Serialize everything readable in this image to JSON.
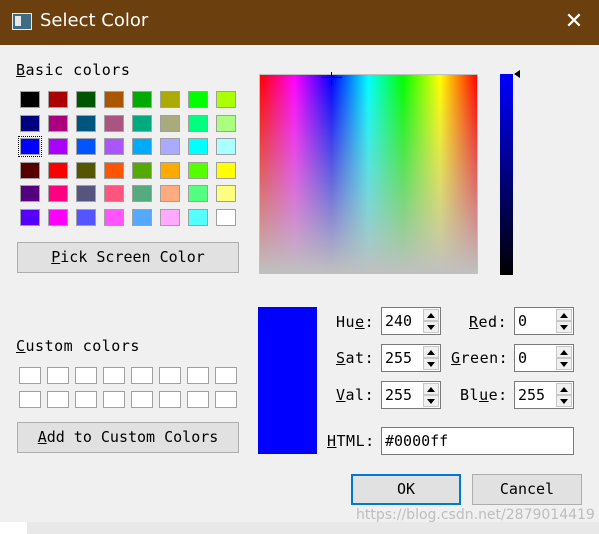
{
  "window": {
    "title": "Select Color",
    "close_glyph": "✕"
  },
  "basic_colors": {
    "label": "Basic colors",
    "selected_index": 16,
    "swatches": [
      "#000000",
      "#aa0000",
      "#005500",
      "#aa5500",
      "#00aa00",
      "#aaaa00",
      "#00ff00",
      "#aaff00",
      "#00007f",
      "#aa007f",
      "#00557f",
      "#aa557f",
      "#00aa7f",
      "#aaaa7f",
      "#00ff7f",
      "#aaff7f",
      "#0000ff",
      "#aa00ff",
      "#0055ff",
      "#aa55ff",
      "#00aaff",
      "#aaaaff",
      "#00ffff",
      "#aaffff",
      "#550000",
      "#ff0000",
      "#555500",
      "#ff5500",
      "#55aa00",
      "#ffaa00",
      "#55ff00",
      "#ffff00",
      "#55007f",
      "#ff007f",
      "#55557f",
      "#ff557f",
      "#55aa7f",
      "#ffaa7f",
      "#55ff7f",
      "#ffff7f",
      "#5500ff",
      "#ff00ff",
      "#5555ff",
      "#ff55ff",
      "#55aaff",
      "#ffaaff",
      "#55ffff",
      "#ffffff"
    ]
  },
  "pick_screen_button": "Pick Screen Color",
  "custom_colors": {
    "label": "Custom colors",
    "count": 16
  },
  "add_custom_button": "Add to Custom Colors",
  "current_color": "#0000ff",
  "fields": {
    "hue": {
      "label": "Hue:",
      "value": "240"
    },
    "sat": {
      "label": "Sat:",
      "value": "255"
    },
    "val": {
      "label": "Val:",
      "value": "255"
    },
    "red": {
      "label": "Red:",
      "value": "0"
    },
    "green": {
      "label": "Green:",
      "value": "0"
    },
    "blue": {
      "label": "Blue:",
      "value": "255"
    },
    "html": {
      "label": "HTML:",
      "value": "#0000ff"
    }
  },
  "buttons": {
    "ok": "OK",
    "cancel": "Cancel"
  },
  "watermark": "https://blog.csdn.net/2879014419"
}
